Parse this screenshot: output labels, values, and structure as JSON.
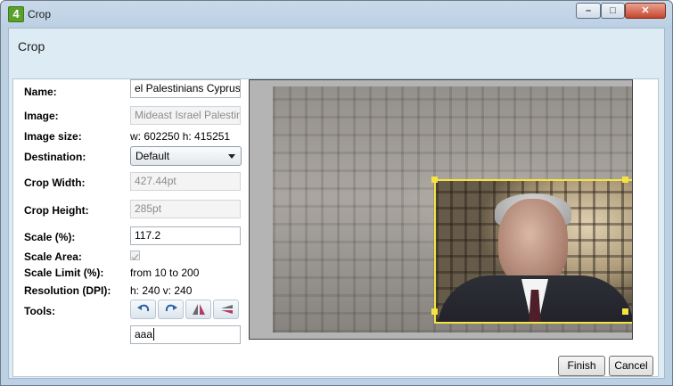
{
  "window": {
    "title": "Crop",
    "app_icon_label": "4"
  },
  "dialog": {
    "heading": "Crop"
  },
  "form": {
    "name_label": "Name:",
    "name_value": "el Palestinians Cyprus",
    "image_label": "Image:",
    "image_value": "Mideast Israel Palestini",
    "image_size_label": "Image size:",
    "image_size_value": "w: 602250 h: 415251",
    "destination_label": "Destination:",
    "destination_value": "Default",
    "crop_width_label": "Crop Width:",
    "crop_width_value": "427.44pt",
    "crop_height_label": "Crop Height:",
    "crop_height_value": "285pt",
    "scale_label": "Scale (%):",
    "scale_value": "117.2",
    "scale_area_label": "Scale Area:",
    "scale_area_checked": true,
    "scale_limit_label": "Scale Limit (%):",
    "scale_limit_value": "from 10 to 200",
    "resolution_label": "Resolution (DPI):",
    "resolution_value": "h: 240 v: 240",
    "tools_label": "Tools:",
    "tools": [
      "undo-icon",
      "redo-icon",
      "flip-horizontal-icon",
      "flip-vertical-icon"
    ],
    "extra_input_value": "aaa"
  },
  "buttons": {
    "finish": "Finish",
    "cancel": "Cancel"
  },
  "window_controls": {
    "minimize": "–",
    "maximize": "□",
    "close": "✕"
  },
  "colors": {
    "crop_box": "#ffe600",
    "window_bg": "#dcebf4"
  }
}
